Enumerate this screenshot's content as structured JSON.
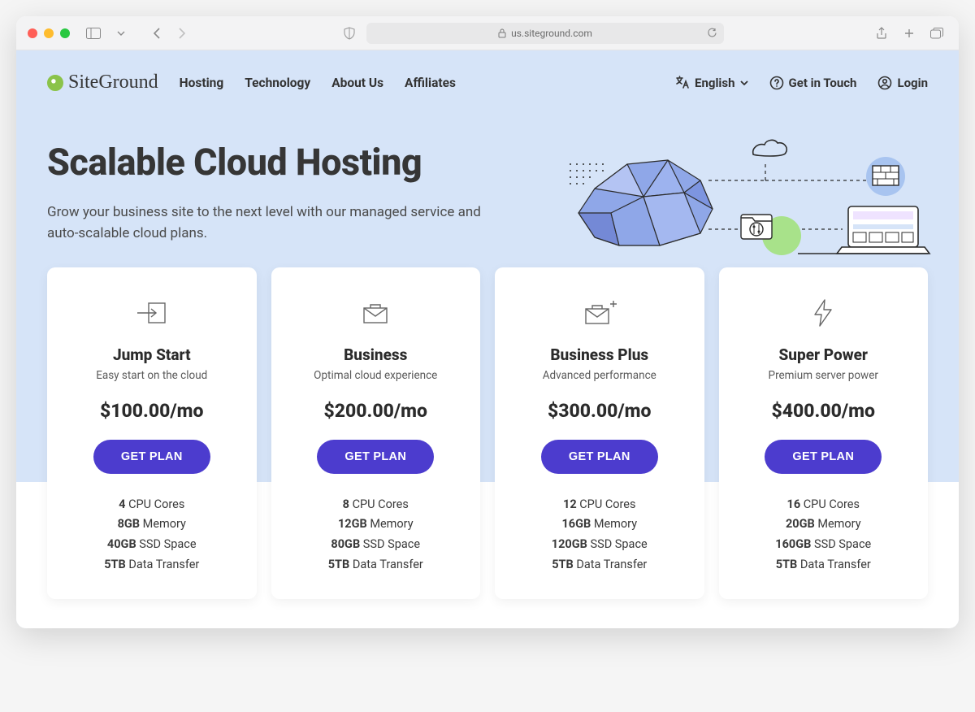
{
  "browser": {
    "url_display": "us.siteground.com"
  },
  "header": {
    "logo_text": "SiteGround",
    "nav": [
      "Hosting",
      "Technology",
      "About Us",
      "Affiliates"
    ],
    "language_label": "English",
    "contact_label": "Get in Touch",
    "login_label": "Login"
  },
  "hero": {
    "title": "Scalable Cloud Hosting",
    "subtitle": "Grow your business site to the next level with our managed service and auto-scalable cloud plans."
  },
  "plans": [
    {
      "icon": "arrow-into-box-icon",
      "name": "Jump Start",
      "tagline": "Easy start on the cloud",
      "price": "$100.00/mo",
      "cta": "GET PLAN",
      "features": [
        {
          "bold": "4",
          "rest": " CPU Cores"
        },
        {
          "bold": "8GB",
          "rest": " Memory"
        },
        {
          "bold": "40GB",
          "rest": " SSD Space"
        },
        {
          "bold": "5TB",
          "rest": " Data Transfer"
        }
      ]
    },
    {
      "icon": "briefcase-icon",
      "name": "Business",
      "tagline": "Optimal cloud experience",
      "price": "$200.00/mo",
      "cta": "GET PLAN",
      "features": [
        {
          "bold": "8",
          "rest": " CPU Cores"
        },
        {
          "bold": "12GB",
          "rest": " Memory"
        },
        {
          "bold": "80GB",
          "rest": " SSD Space"
        },
        {
          "bold": "5TB",
          "rest": " Data Transfer"
        }
      ]
    },
    {
      "icon": "briefcase-plus-icon",
      "name": "Business Plus",
      "tagline": "Advanced performance",
      "price": "$300.00/mo",
      "cta": "GET PLAN",
      "features": [
        {
          "bold": "12",
          "rest": " CPU Cores"
        },
        {
          "bold": "16GB",
          "rest": " Memory"
        },
        {
          "bold": "120GB",
          "rest": " SSD Space"
        },
        {
          "bold": "5TB",
          "rest": " Data Transfer"
        }
      ]
    },
    {
      "icon": "lightning-icon",
      "name": "Super Power",
      "tagline": "Premium server power",
      "price": "$400.00/mo",
      "cta": "GET PLAN",
      "features": [
        {
          "bold": "16",
          "rest": " CPU Cores"
        },
        {
          "bold": "20GB",
          "rest": " Memory"
        },
        {
          "bold": "160GB",
          "rest": " SSD Space"
        },
        {
          "bold": "5TB",
          "rest": " Data Transfer"
        }
      ]
    }
  ]
}
